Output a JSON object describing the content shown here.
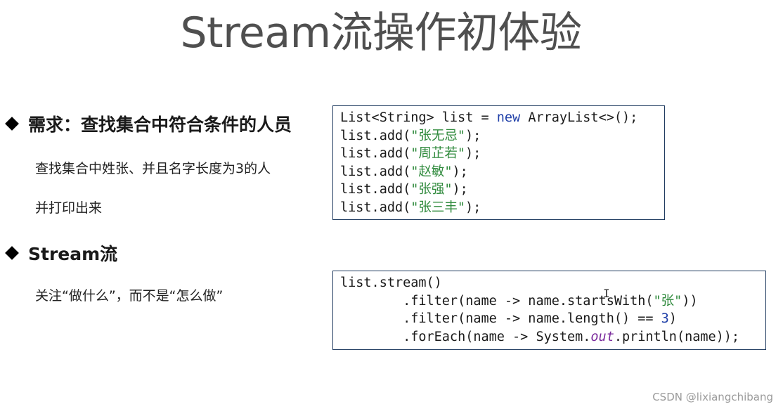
{
  "slide": {
    "title": "Stream流操作初体验",
    "section1": {
      "heading": "需求：查找集合中符合条件的人员",
      "lines": [
        "查找集合中姓张、并且名字长度为3的人",
        "并打印出来"
      ]
    },
    "section2": {
      "heading": "Stream流",
      "lines": [
        "关注“做什么”，而不是“怎么做”"
      ]
    },
    "code1": {
      "line1": {
        "a": "List<String> list = ",
        "kw": "new",
        "b": " ArrayList<>();"
      },
      "adds": [
        {
          "pre": "list.add(",
          "str": "\"张无忌\"",
          "post": ");"
        },
        {
          "pre": "list.add(",
          "str": "\"周芷若\"",
          "post": ");"
        },
        {
          "pre": "list.add(",
          "str": "\"赵敏\"",
          "post": ");"
        },
        {
          "pre": "list.add(",
          "str": "\"张强\"",
          "post": ");"
        },
        {
          "pre": "list.add(",
          "str": "\"张三丰\"",
          "post": ");"
        }
      ]
    },
    "code2": {
      "line1": "list.stream()",
      "line2": {
        "pre": "        .filter(name -> name.startsWith(",
        "str": "\"张\"",
        "post": "))"
      },
      "line3": {
        "pre": "        .filter(name -> name.length() == ",
        "num": "3",
        "post": ")"
      },
      "line4": {
        "pre": "        .forEach(name -> System.",
        "it": "out",
        "post": ".println(name));"
      }
    },
    "cursor_glyph": "I",
    "watermark": "CSDN @lixiangchibang"
  }
}
